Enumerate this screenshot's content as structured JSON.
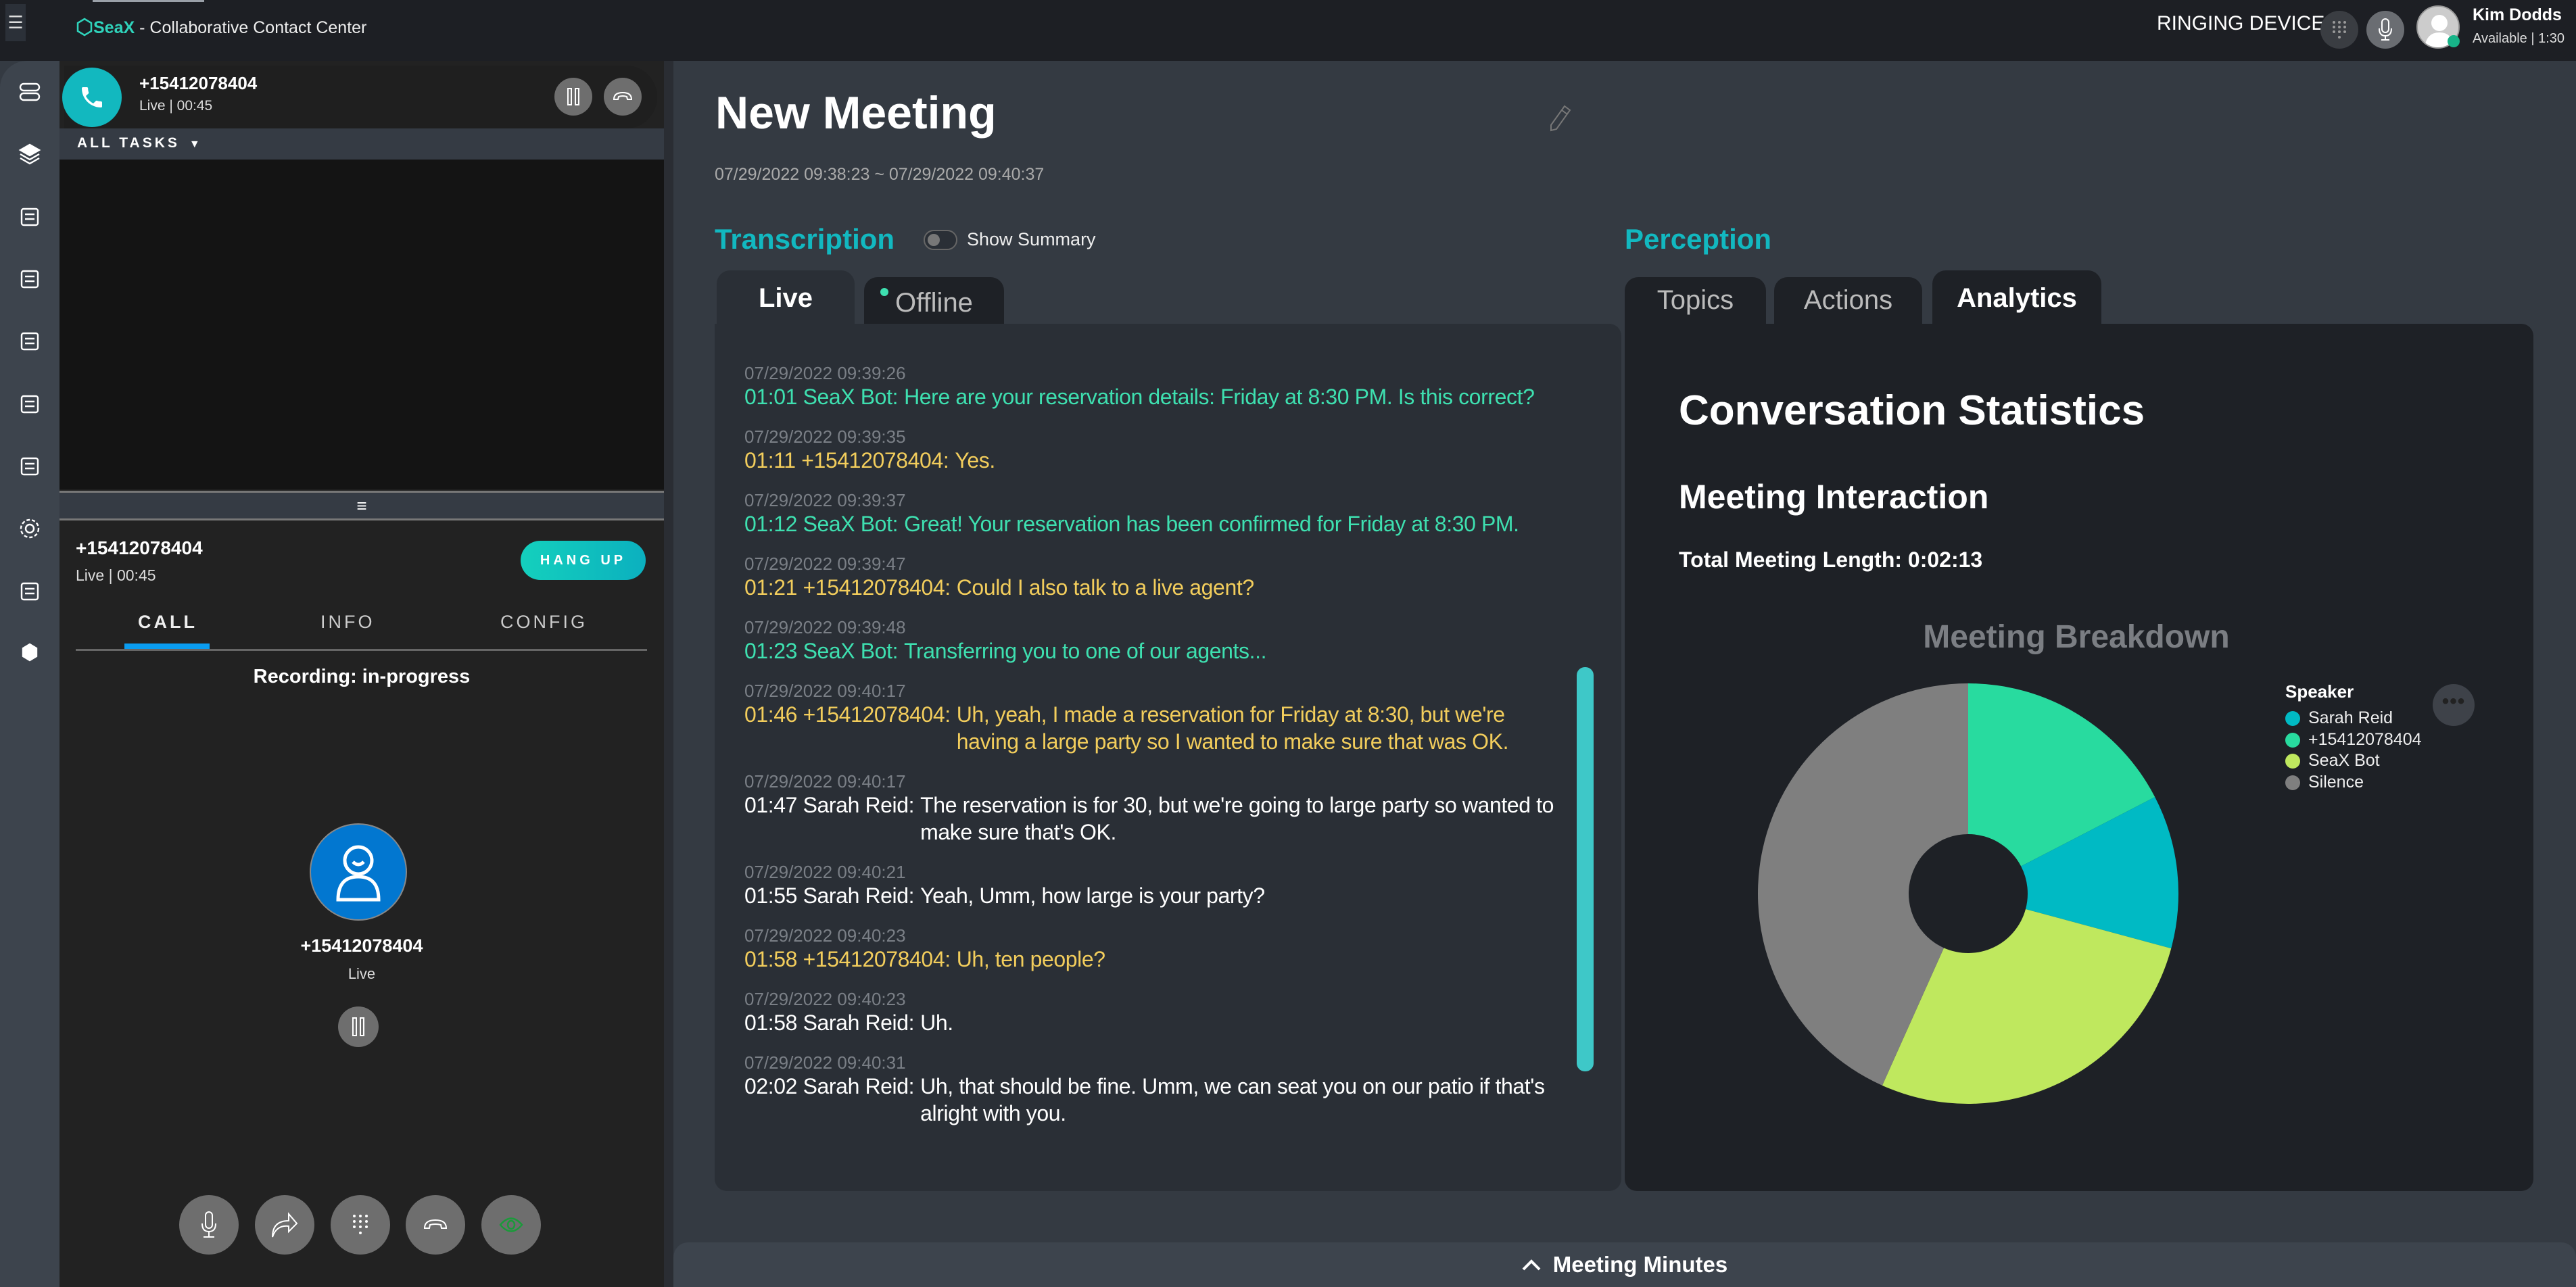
{
  "app": {
    "menu_icon": "hamburger-icon",
    "brand": "SeaX",
    "title_rest": " - Collaborative Contact Center"
  },
  "header": {
    "status": "RINGING DEVICE",
    "user_name": "Kim Dodds",
    "user_status": "Available | 1:30",
    "status_color": "#17b488"
  },
  "rail": {
    "icons": [
      "queue-icon",
      "layers-icon",
      "contacts-icon",
      "tasks-icon",
      "analytics-icon",
      "reports-icon",
      "notes-icon",
      "settings-icon",
      "chat-icon",
      "seax-hub-icon"
    ]
  },
  "active_call": {
    "number": "+15412078404",
    "status": "Live | 00:45"
  },
  "tasks": {
    "filter_label": "ALL TASKS"
  },
  "call_detail": {
    "number": "+15412078404",
    "status": "Live | 00:45",
    "hangup_label": "HANG UP",
    "tabs": [
      {
        "label": "CALL",
        "active": true
      },
      {
        "label": "INFO"
      },
      {
        "label": "CONFIG"
      }
    ],
    "recording": "Recording: in-progress",
    "party_number": "+15412078404",
    "party_status": "Live"
  },
  "meeting": {
    "title": "New Meeting",
    "dates": "07/29/2022 09:38:23 ~ 07/29/2022 09:40:37"
  },
  "transcription": {
    "heading": "Transcription",
    "summary_toggle": "Show Summary",
    "summary_on": false,
    "tabs": [
      {
        "label": "Live",
        "active": true
      },
      {
        "label": "Offline"
      }
    ],
    "entries": [
      {
        "ts": "07/29/2022 09:39:26",
        "prefix": "01:01 SeaX Bot:",
        "text": "Here are your reservation details: Friday at 8:30 PM. Is this correct?",
        "role": "bot"
      },
      {
        "ts": "07/29/2022 09:39:35",
        "prefix": "01:11 +15412078404:",
        "text": "Yes.",
        "role": "caller"
      },
      {
        "ts": "07/29/2022 09:39:37",
        "prefix": "01:12 SeaX Bot:",
        "text": "Great! Your reservation has been confirmed for Friday at 8:30 PM.",
        "role": "bot"
      },
      {
        "ts": "07/29/2022 09:39:47",
        "prefix": "01:21 +15412078404:",
        "text": "Could I also talk to a live agent?",
        "role": "caller"
      },
      {
        "ts": "07/29/2022 09:39:48",
        "prefix": "01:23 SeaX Bot:",
        "text": "Transferring you to one of our agents...",
        "role": "bot"
      },
      {
        "ts": "07/29/2022 09:40:17",
        "prefix": "01:46 +15412078404:",
        "text": "Uh, yeah, I made a reservation for Friday at 8:30, but we're having a large party so I wanted to make sure that was OK.",
        "role": "caller"
      },
      {
        "ts": "07/29/2022 09:40:17",
        "prefix": "01:47 Sarah Reid:",
        "text": "The reservation is for 30, but we're going to large party so wanted to make sure that's OK.",
        "role": "agent"
      },
      {
        "ts": "07/29/2022 09:40:21",
        "prefix": "01:55 Sarah Reid:",
        "text": "Yeah, Umm, how large is your party?",
        "role": "agent"
      },
      {
        "ts": "07/29/2022 09:40:23",
        "prefix": "01:58 +15412078404:",
        "text": "Uh, ten people?",
        "role": "caller"
      },
      {
        "ts": "07/29/2022 09:40:23",
        "prefix": "01:58 Sarah Reid:",
        "text": "Uh.",
        "role": "agent"
      },
      {
        "ts": "07/29/2022 09:40:31",
        "prefix": "02:02 Sarah Reid:",
        "text": "Uh, that should be fine. Umm, we can seat you on our patio if that's alright with you.",
        "role": "agent"
      }
    ]
  },
  "perception": {
    "heading": "Perception",
    "tabs": [
      {
        "label": "Topics"
      },
      {
        "label": "Actions"
      },
      {
        "label": "Analytics",
        "active": true
      }
    ],
    "stats_title": "Conversation Statistics",
    "interaction_title": "Meeting Interaction",
    "total_length": "Total Meeting Length: 0:02:13"
  },
  "chart_data": {
    "type": "pie",
    "style": "donut",
    "title": "Meeting Breakdown",
    "legend_title": "Speaker",
    "legend_placement": "right",
    "legend": [
      "Sarah Reid",
      "+15412078404",
      "SeaX Bot",
      "Silence"
    ],
    "slices": [
      {
        "name": "+15412078404",
        "value": 17.4,
        "color": "#28db9f"
      },
      {
        "name": "Sarah Reid",
        "value": 11.8,
        "color": "#00bac4"
      },
      {
        "name": "SeaX Bot",
        "value": 27.5,
        "color": "#bfe85e"
      },
      {
        "name": "Silence",
        "value": 43.3,
        "color": "#7f7f7f"
      }
    ],
    "unit": "percent of meeting"
  },
  "footer": {
    "minutes_label": "Meeting Minutes"
  }
}
